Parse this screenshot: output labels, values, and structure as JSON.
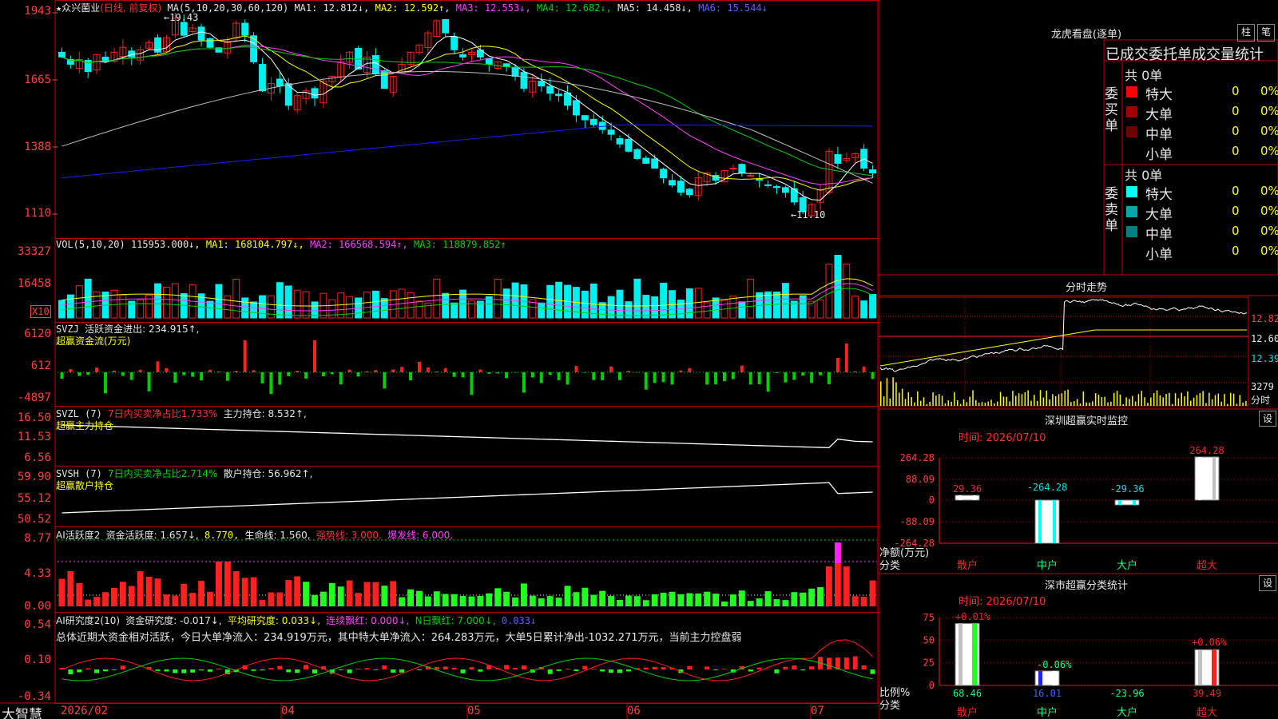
{
  "colors": {
    "up": "#ff2020",
    "down": "#00f0f0",
    "ma1": "#ffffff",
    "ma2": "#ffff00",
    "ma3": "#ff40ff",
    "ma4": "#00d000",
    "ma5": "#c0c0c0",
    "ma6": "#1c1cff",
    "axis": "#ff4040",
    "grid": "#c00000"
  },
  "main": {
    "stock_star": "★",
    "stock_name": "众兴菌业",
    "mode": "(日线, 前复权)",
    "ma_label": "MA(5,10,20,30,60,120)",
    "ma1": "MA1: 12.812↓,",
    "ma2": "MA2: 12.592↑,",
    "ma3": "MA3: 12.553↓,",
    "ma4": "MA4: 12.682↓,",
    "ma5": "MA5: 14.458↓,",
    "ma6": "MA6: 15.544↓",
    "y_ticks": [
      "1943",
      "1665",
      "1388",
      "1110"
    ],
    "high_label": "←19.43",
    "low_label": "←11.10"
  },
  "vol": {
    "label": "VOL(5,10,20)",
    "value": "115953.000↓,",
    "ma1": "MA1: 168104.797↓,",
    "ma2": "MA2: 166568.594↑,",
    "ma3": "MA3: 118879.852↑",
    "y_ticks": [
      "33327",
      "16458"
    ],
    "unit": "X10"
  },
  "svzj": {
    "label": "SVZJ",
    "line1": "活跃资金进出: 234.915↑,",
    "line2": "超赢资金流(万元)",
    "y_ticks": [
      "6120",
      "612",
      "-4897"
    ]
  },
  "svzl": {
    "label": "SVZL (7)",
    "a": "7日内买卖净占比1.733%",
    "b": "主力持仓: 8.532↑,",
    "line2": "超赢主力持仓",
    "y_ticks": [
      "16.50",
      "11.53",
      "6.56"
    ]
  },
  "svsh": {
    "label": "SVSH (7)",
    "a": "7日内买卖净占比2.714%",
    "b": "散户持仓: 56.962↑,",
    "line2": "超赢散户持仓",
    "y_ticks": [
      "59.90",
      "55.12",
      "50.52"
    ]
  },
  "ai1": {
    "label": "AI活跃度2",
    "a": "资金活跃度: 1.657↓,",
    "b": "8.770,",
    "c": "生命线: 1.560,",
    "d": "强势线: 3.000,",
    "e": "爆发线: 6.000,",
    "y_ticks": [
      "8.77",
      "4.33",
      "0.00"
    ]
  },
  "ai2": {
    "label": "AI研究度2(10)",
    "a": "资金研究度: -0.017↓,",
    "b": "平均研究度: 0.033↓,",
    "c": "连续飘红: 0.000↓,",
    "d": "N日飘红: 7.000↓,",
    "e": "0.033↓",
    "comment": "总体近期大资金相对活跃，今日大单净流入：234.919万元，其中特大单净流入：264.283万元，大单5日累计净出-1032.271万元，当前主力控盘弱",
    "y_ticks": [
      "0.54",
      "0.10",
      "-0.34"
    ]
  },
  "xaxis": {
    "labels": [
      "2026/02",
      "04",
      "05",
      "06",
      "07"
    ]
  },
  "brand": "大智慧",
  "right": {
    "lh_title": "龙虎看盘(逐单)",
    "btn_bar": "柱",
    "btn_pen": "笔",
    "stat_title": "已成交委托单成交量统计",
    "buy_side": "委买单",
    "sell_side": "委卖单",
    "buy_total": "共 0单",
    "sell_total": "共 0单",
    "buy_rows": [
      {
        "name": "特大",
        "v": "0",
        "p": "0%",
        "color": "#ff0000"
      },
      {
        "name": "大单",
        "v": "0",
        "p": "0%",
        "color": "#a00000"
      },
      {
        "name": "中单",
        "v": "0",
        "p": "0%",
        "color": "#700000"
      },
      {
        "name": "小单",
        "v": "0",
        "p": "0%",
        "color": "#000000"
      }
    ],
    "sell_rows": [
      {
        "name": "特大",
        "v": "0",
        "p": "0%",
        "color": "#00ffff"
      },
      {
        "name": "大单",
        "v": "0",
        "p": "0%",
        "color": "#00a8a8"
      },
      {
        "name": "中单",
        "v": "0",
        "p": "0%",
        "color": "#008080"
      },
      {
        "name": "小单",
        "v": "0",
        "p": "0%",
        "color": "#000000"
      }
    ],
    "fs_title": "分时走势",
    "fs_ticks": [
      "12.82",
      "12.60",
      "12.39"
    ],
    "fs_vol": "3279",
    "fs_unit": "分时",
    "sz_title": "深圳超赢实时监控",
    "sz_setting": "设",
    "sz_time": "时间: 2026/07/10",
    "sz_ticks": [
      "264.28",
      "88.09",
      "0",
      "-88.09",
      "-264.28"
    ],
    "sz_ylab": "净额(万元)",
    "sz_xlab": "分类",
    "sz_cats": [
      "散户",
      "中户",
      "大户",
      "超大"
    ],
    "sz_vals": [
      "29.36",
      "-264.28",
      "-29.36",
      "264.28"
    ],
    "sc_title": "深市超赢分类统计",
    "sc_setting": "设",
    "sc_time": "时间: 2026/07/10",
    "sc_ticks": [
      "75",
      "50",
      "25",
      "0"
    ],
    "sc_ylab": "比例%",
    "sc_xlab": "分类",
    "sc_cats": [
      "散户",
      "中户",
      "大户",
      "超大"
    ],
    "sc_top": [
      "+0.01%",
      "",
      "",
      "+0.06%"
    ],
    "sc_mid": [
      "",
      "-0.06%",
      "",
      ""
    ],
    "sc_bottom": [
      "68.46",
      "16.01",
      "-23.96",
      "39.49"
    ]
  },
  "chart_data": [
    {
      "type": "candlestick",
      "title": "众兴菌业 (日线, 前复权)",
      "ylim": [
        11.0,
        19.6
      ],
      "y_ticks": [
        19.43,
        16.65,
        13.88,
        11.1
      ],
      "x_ticks": [
        "2026/02",
        "04",
        "05",
        "06",
        "07"
      ],
      "series": [
        {
          "name": "MA1"
        },
        {
          "name": "MA2"
        },
        {
          "name": "MA3"
        },
        {
          "name": "MA4"
        },
        {
          "name": "MA5"
        },
        {
          "name": "MA6"
        }
      ],
      "close": [
        17.6,
        17.3,
        17.5,
        17.0,
        17.7,
        17.4,
        17.8,
        18.0,
        17.6,
        17.9,
        18.2,
        17.8,
        18.4,
        19.2,
        18.5,
        18.8,
        18.3,
        18.0,
        17.8,
        18.2,
        19.0,
        18.5,
        17.4,
        16.2,
        16.5,
        16.4,
        15.6,
        16.0,
        16.2,
        15.9,
        16.6,
        16.8,
        17.4,
        17.8,
        17.1,
        17.6,
        16.9,
        16.3,
        16.8,
        17.3,
        17.8,
        18.1,
        18.6,
        19.1,
        18.6,
        17.9,
        17.6,
        17.8,
        17.6,
        17.3,
        17.4,
        17.2,
        16.8,
        16.3,
        16.6,
        16.4,
        16.1,
        16.0,
        15.6,
        15.2,
        15.0,
        14.8,
        14.6,
        14.4,
        14.0,
        13.7,
        13.4,
        13.2,
        13.0,
        12.6,
        12.3,
        12.0,
        11.9,
        12.6,
        12.8,
        12.5,
        12.9,
        13.0,
        12.8,
        12.7,
        12.5,
        12.3,
        12.2,
        12.0,
        11.6,
        11.2,
        11.5,
        12.1,
        13.7,
        13.2,
        13.4,
        13.6,
        13.0,
        12.8
      ]
    },
    {
      "type": "bar",
      "title": "VOL(5,10,20)",
      "ylim": [
        0,
        40000
      ],
      "series": [
        {
          "name": "MA1"
        },
        {
          "name": "MA2"
        },
        {
          "name": "MA3"
        }
      ]
    },
    {
      "type": "bar",
      "title": "SVZJ 超赢资金流(万元)",
      "ylim": [
        -4897,
        6120
      ]
    },
    {
      "type": "line",
      "title": "SVZL 超赢主力持仓",
      "ylim": [
        6.56,
        16.5
      ]
    },
    {
      "type": "line",
      "title": "SVSH 超赢散户持仓",
      "ylim": [
        50.52,
        59.9
      ]
    },
    {
      "type": "bar",
      "title": "AI活跃度2",
      "ylim": [
        0,
        8.77
      ]
    },
    {
      "type": "bar",
      "title": "AI研究度2(10)",
      "ylim": [
        -0.34,
        0.54
      ]
    },
    {
      "type": "line",
      "title": "分时走势",
      "ylim": [
        12.3,
        12.9
      ],
      "y_ticks": [
        12.82,
        12.6,
        12.39
      ]
    },
    {
      "type": "bar",
      "title": "深圳超赢实时监控",
      "categories": [
        "散户",
        "中户",
        "大户",
        "超大"
      ],
      "values": [
        29.36,
        -264.28,
        -29.36,
        264.28
      ],
      "ylim": [
        -264.28,
        264.28
      ],
      "ylabel": "净额(万元)",
      "xlabel": "分类"
    },
    {
      "type": "bar",
      "title": "深市超赢分类统计",
      "categories": [
        "散户",
        "中户",
        "大户",
        "超大"
      ],
      "values": [
        68.46,
        16.01,
        -23.96,
        39.49
      ],
      "ylim": [
        0,
        75
      ],
      "ylabel": "比例%",
      "xlabel": "分类"
    }
  ]
}
